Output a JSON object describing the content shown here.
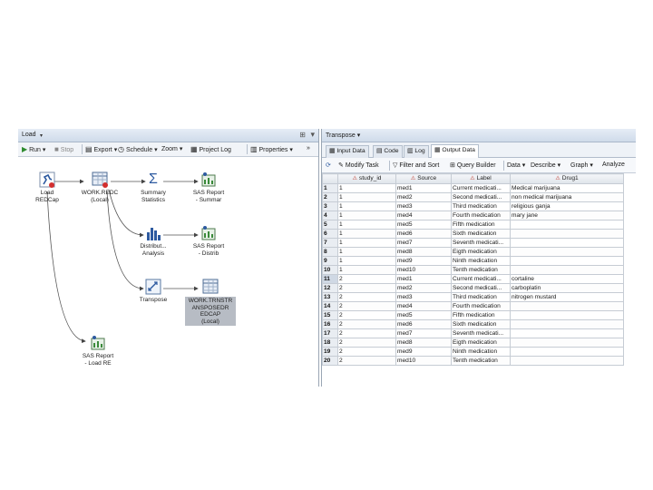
{
  "left_pane": {
    "title": "Load",
    "toolbar": {
      "run": "Run",
      "stop": "Stop",
      "export": "Export",
      "schedule": "Schedule",
      "zoom": "Zoom",
      "project_log": "Project Log",
      "properties": "Properties"
    },
    "nodes": {
      "load_redcap": "Load\nREDCap",
      "work_redc": "WORK.REDC\n(Local)",
      "summary_statistics": "Summary\nStatistics",
      "sas_report_summar": "SAS Report\n- Summar",
      "distribut_analysis": "Distribut...\nAnalysis",
      "sas_report_distrib": "SAS Report\n- Distrib",
      "transpose": "Transpose",
      "work_transpose": "WORK.TRNSTR\nANSPOSEDR\nEDCAP\n(Local)",
      "sas_report_load": "SAS Report\n- Load RE"
    }
  },
  "right_pane": {
    "title": "Transpose",
    "tabs": [
      "Input Data",
      "Code",
      "Log",
      "Output Data"
    ],
    "active_tab": "Output Data",
    "toolbar": {
      "modify_task": "Modify Task",
      "filter_sort": "Filter and Sort",
      "query_builder": "Query Builder",
      "data": "Data",
      "describe": "Describe",
      "graph": "Graph",
      "analyze": "Analyze"
    },
    "columns": [
      "study_id",
      "Source",
      "Label",
      "Drug1"
    ],
    "rows": [
      [
        "1",
        "1",
        "med1",
        "Current medicati...",
        "Medical marijuana"
      ],
      [
        "2",
        "1",
        "med2",
        "Second medicati...",
        "non medical marijuana"
      ],
      [
        "3",
        "1",
        "med3",
        "Third medication",
        "religious ganja"
      ],
      [
        "4",
        "1",
        "med4",
        "Fourth medication",
        "mary jane"
      ],
      [
        "5",
        "1",
        "med5",
        "Fifth medication",
        ""
      ],
      [
        "6",
        "1",
        "med6",
        "Sixth medication",
        ""
      ],
      [
        "7",
        "1",
        "med7",
        "Seventh medicati...",
        ""
      ],
      [
        "8",
        "1",
        "med8",
        "Eigth medication",
        ""
      ],
      [
        "9",
        "1",
        "med9",
        "Ninth medication",
        ""
      ],
      [
        "10",
        "1",
        "med10",
        "Tenth medication",
        ""
      ],
      [
        "11",
        "2",
        "med1",
        "Current medicati...",
        "cortaline"
      ],
      [
        "12",
        "2",
        "med2",
        "Second medicati...",
        "carboplatin"
      ],
      [
        "13",
        "2",
        "med3",
        "Third medication",
        "nitrogen mustard"
      ],
      [
        "14",
        "2",
        "med4",
        "Fourth medication",
        ""
      ],
      [
        "15",
        "2",
        "med5",
        "Fifth medication",
        ""
      ],
      [
        "16",
        "2",
        "med6",
        "Sixth medication",
        ""
      ],
      [
        "17",
        "2",
        "med7",
        "Seventh medicati...",
        ""
      ],
      [
        "18",
        "2",
        "med8",
        "Eigth medication",
        ""
      ],
      [
        "19",
        "2",
        "med9",
        "Ninth medication",
        ""
      ],
      [
        "20",
        "2",
        "med10",
        "Tenth medication",
        ""
      ]
    ]
  },
  "colors": {
    "accent": "#3a6ea5",
    "selection": "#b7bcc4",
    "header": "#dfe4ea"
  }
}
